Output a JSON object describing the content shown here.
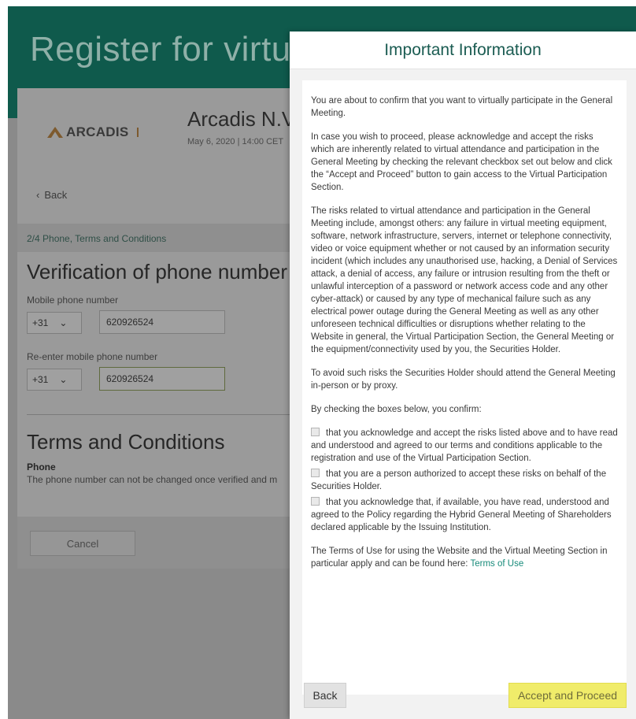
{
  "background": {
    "page_title": "Register for virtu",
    "company_name": "Arcadis N.V.",
    "company_date": "May 6, 2020 | 14:00 CET",
    "logo_text": "ARCADIS",
    "back_label": "Back",
    "step_label": "2/4 Phone, Terms and Conditions",
    "verify_heading": "Verification of phone number",
    "mobile_label": "Mobile phone number",
    "country_code": "+31",
    "phone_value": "620926524",
    "reenter_label": "Re-enter mobile phone number",
    "country_code_2": "+31",
    "phone_value_2": "620926524",
    "terms_heading": "Terms and Conditions",
    "phone_sub_label": "Phone",
    "phone_note": "The phone number can not be changed once verified and m",
    "cancel_label": "Cancel"
  },
  "modal": {
    "title": "Important Information",
    "para1": "You are about to confirm that you want to virtually participate in the General Meeting.",
    "para2": "In case you wish to proceed, please acknowledge and accept the risks which are inherently related to virtual attendance and participation in the General Meeting by checking the relevant checkbox set out below and click the “Accept and Proceed” button to gain access to the Virtual Participation Section.",
    "para3": "The risks related to virtual attendance and participation in the General Meeting include, amongst others: any failure in virtual meeting equipment, software, network infrastructure, servers, internet or telephone connectivity, video or voice equipment whether or not caused by an information security incident (which includes any unauthorised use, hacking, a Denial of Services attack, a denial of access, any failure or intrusion resulting from the theft or unlawful interception of a password or network access code and any other cyber-attack) or caused by any type of mechanical failure such as any electrical power outage during the General Meeting as well as any other unforeseen technical difficulties or disruptions whether relating to the Website in general, the Virtual Participation Section, the General Meeting or the equipment/connectivity used by you, the Securities Holder.",
    "para4": "To avoid such risks the Securities Holder should attend the General Meeting in-person or by proxy.",
    "para5": "By checking the boxes below, you confirm:",
    "checkbox1": "that you acknowledge and accept the risks listed above and to have read and understood and agreed to our terms and conditions applicable to the registration and use of the Virtual Participation Section.",
    "checkbox2": "that you are a person authorized to accept these risks on behalf of the Securities Holder.",
    "checkbox3": "that you acknowledge that, if available, you have read, understood and agreed to the Policy regarding the Hybrid General Meeting of Shareholders declared applicable by the Issuing Institution.",
    "terms_text": "The Terms of Use for using the Website and the Virtual Meeting Section in particular apply and can be found here:",
    "terms_link": "Terms of Use",
    "back_button": "Back",
    "proceed_button": "Accept and Proceed"
  },
  "icons": {
    "back_chevron": "chevron-left-icon",
    "dropdown_chevron": "chevron-down-icon"
  },
  "colors": {
    "header_green": "#0f5a4c",
    "title_green": "#1b5c52",
    "link_teal": "#168a79",
    "proceed_yellow": "#f0ec6a"
  }
}
